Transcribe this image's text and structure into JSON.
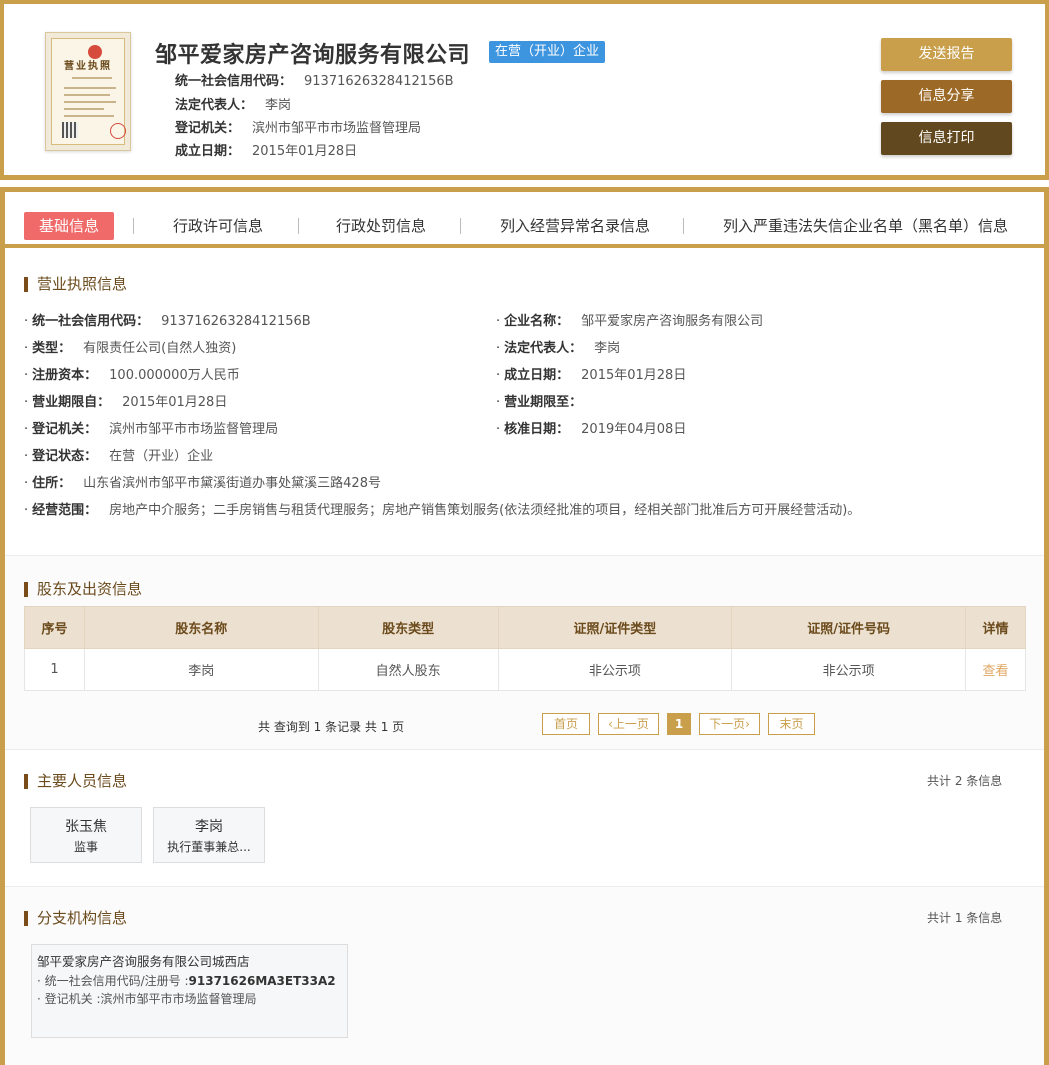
{
  "header": {
    "license_title": "营业执照",
    "company_name": "邹平爱家房产咨询服务有限公司",
    "status": "在营（开业）企业",
    "info": [
      {
        "key": "统一社会信用代码：",
        "value": "91371626328412156B"
      },
      {
        "key": "法定代表人：",
        "value": "李岗"
      },
      {
        "key": "登记机关：",
        "value": "滨州市邹平市市场监督管理局"
      },
      {
        "key": "成立日期：",
        "value": "2015年01月28日"
      }
    ],
    "buttons": {
      "send": "发送报告",
      "share": "信息分享",
      "print": "信息打印"
    }
  },
  "tabs": [
    "基础信息",
    "行政许可信息",
    "行政处罚信息",
    "列入经营异常名录信息",
    "列入严重违法失信企业名单（黑名单）信息"
  ],
  "license_section": {
    "title": "营业执照信息",
    "left": [
      {
        "key": "统一社会信用代码：",
        "value": "91371626328412156B"
      },
      {
        "key": "类型：",
        "value": "有限责任公司(自然人独资)"
      },
      {
        "key": "注册资本：",
        "value": "100.000000万人民币"
      },
      {
        "key": "营业期限自：",
        "value": "2015年01月28日"
      },
      {
        "key": "登记机关：",
        "value": "滨州市邹平市市场监督管理局"
      },
      {
        "key": "登记状态：",
        "value": "在营（开业）企业"
      },
      {
        "key": "住所：",
        "value": "山东省滨州市邹平市黛溪街道办事处黛溪三路428号"
      },
      {
        "key": "经营范围：",
        "value": "房地产中介服务；二手房销售与租赁代理服务；房地产销售策划服务(依法须经批准的项目，经相关部门批准后方可开展经营活动)。"
      }
    ],
    "right": [
      {
        "key": "企业名称：",
        "value": "邹平爱家房产咨询服务有限公司"
      },
      {
        "key": "法定代表人：",
        "value": "李岗"
      },
      {
        "key": "成立日期：",
        "value": "2015年01月28日"
      },
      {
        "key": "营业期限至：",
        "value": ""
      },
      {
        "key": "核准日期：",
        "value": "2019年04月08日"
      }
    ],
    "bullet": "·"
  },
  "shareholders": {
    "title": "股东及出资信息",
    "columns": [
      "序号",
      "股东名称",
      "股东类型",
      "证照/证件类型",
      "证照/证件号码",
      "详情"
    ],
    "rows": [
      {
        "no": "1",
        "name": "李岗",
        "type": "自然人股东",
        "id_type": "非公示项",
        "id_no": "非公示项",
        "detail": "查看"
      }
    ],
    "pager": {
      "summary": "共 查询到 1 条记录 共 1 页",
      "first": "首页",
      "prev": "上一页",
      "current": "1",
      "next": "下一页",
      "last": "末页"
    }
  },
  "personnel": {
    "title": "主要人员信息",
    "count": "共计 2 条信息",
    "people": [
      {
        "name": "张玉焦",
        "role": "监事"
      },
      {
        "name": "李岗",
        "role": "执行董事兼总..."
      }
    ]
  },
  "branches": {
    "title": "分支机构信息",
    "count": "共计 1 条信息",
    "items": [
      {
        "name": "邹平爱家房产咨询服务有限公司城西店",
        "code_label": "· 统一社会信用代码/注册号 :",
        "code": "91371626MA3ET33A2",
        "org_label": "· 登记机关 :",
        "org": "滨州市邹平市市场监督管理局"
      }
    ]
  }
}
